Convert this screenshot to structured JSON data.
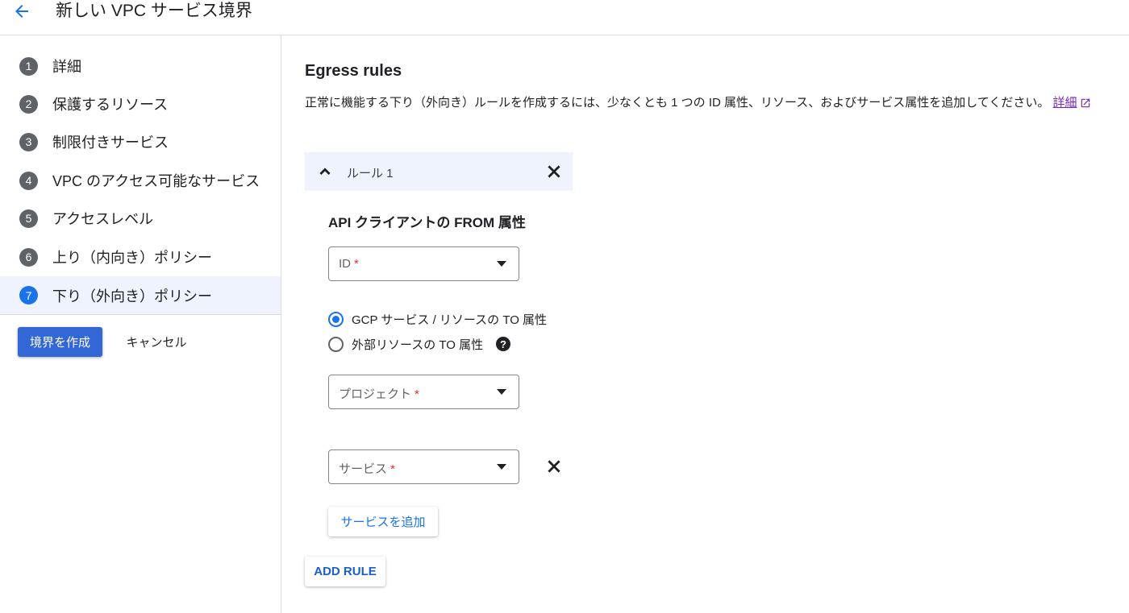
{
  "header": {
    "title": "新しい VPC サービス境界",
    "back_icon": "arrow-left-icon"
  },
  "sidebar": {
    "steps": [
      {
        "num": "1",
        "label": "詳細"
      },
      {
        "num": "2",
        "label": "保護するリソース"
      },
      {
        "num": "3",
        "label": "制限付きサービス"
      },
      {
        "num": "4",
        "label": "VPC のアクセス可能なサービス"
      },
      {
        "num": "5",
        "label": "アクセスレベル"
      },
      {
        "num": "6",
        "label": "上り（内向き）ポリシー"
      },
      {
        "num": "7",
        "label": "下り（外向き）ポリシー"
      }
    ],
    "active_step": "7",
    "create_label": "境界を作成",
    "cancel_label": "キャンセル"
  },
  "main": {
    "title": "Egress rules",
    "description": "正常に機能する下り（外向き）ルールを作成するには、少なくとも 1 つの ID 属性、リソース、およびサービス属性を追加してください。",
    "learn_more": "詳細",
    "rule": {
      "label": "ルール 1",
      "from_heading": "API クライアントの FROM 属性",
      "id_select": {
        "label": "ID",
        "required": "*"
      },
      "to_options": [
        {
          "label": "GCP サービス / リソースの TO 属性",
          "checked": true
        },
        {
          "label": "外部リソースの TO 属性",
          "checked": false
        }
      ],
      "project_select": {
        "label": "プロジェクト",
        "required": "*"
      },
      "service_select": {
        "label": "サービス",
        "required": "*"
      },
      "add_service_label": "サービスを追加"
    },
    "add_rule_label": "ADD RULE"
  },
  "colors": {
    "accent": "#1a73e8",
    "primary_button": "#3367d6",
    "active_step_bg": "#eef3fd",
    "required": "#d93025"
  }
}
